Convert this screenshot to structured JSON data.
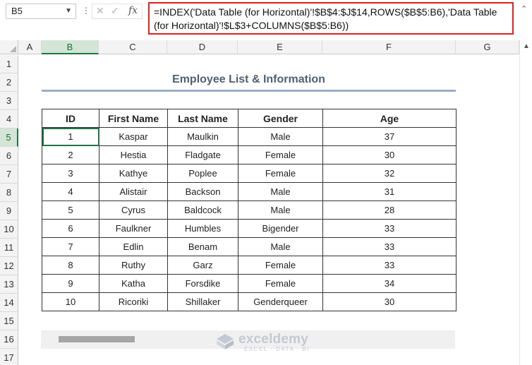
{
  "formula_bar": {
    "name_box": "B5",
    "formula_line1": "=INDEX('Data Table (for Horizontal)'!$B$4:$J$14,ROWS($B$5:B6),'Data Table",
    "formula_line2": "(for Horizontal)'!$L$3+COLUMNS($B$5:B6))"
  },
  "columns": [
    "A",
    "B",
    "C",
    "D",
    "E",
    "F",
    "G"
  ],
  "rows": [
    "1",
    "2",
    "3",
    "4",
    "5",
    "6",
    "7",
    "8",
    "9",
    "10",
    "11",
    "12",
    "13",
    "14",
    "15",
    "16",
    "17"
  ],
  "selected_cell": {
    "column": "B",
    "row": "5"
  },
  "sheet": {
    "title": "Employee List & Information",
    "headers": [
      "ID",
      "First Name",
      "Last Name",
      "Gender",
      "Age"
    ],
    "rows": [
      [
        "1",
        "Kaspar",
        "Maulkin",
        "Male",
        "37"
      ],
      [
        "2",
        "Hestia",
        "Fladgate",
        "Female",
        "30"
      ],
      [
        "3",
        "Kathye",
        "Poplee",
        "Female",
        "32"
      ],
      [
        "4",
        "Alistair",
        "Backson",
        "Male",
        "31"
      ],
      [
        "5",
        "Cyrus",
        "Baldcock",
        "Male",
        "28"
      ],
      [
        "6",
        "Faulkner",
        "Humbles",
        "Bigender",
        "33"
      ],
      [
        "7",
        "Edlin",
        "Benam",
        "Male",
        "33"
      ],
      [
        "8",
        "Ruthy",
        "Garz",
        "Female",
        "33"
      ],
      [
        "9",
        "Katha",
        "Forsdike",
        "Female",
        "34"
      ],
      [
        "10",
        "Ricoriki",
        "Shillaker",
        "Genderqueer",
        "30"
      ]
    ]
  },
  "watermark": {
    "name": "exceldemy",
    "tagline": "EXCEL · DATA · BI"
  },
  "colors": {
    "accent": "#217346",
    "formula_border": "#e02020",
    "title_text": "#4f6171",
    "title_rule": "#9aaec8"
  }
}
